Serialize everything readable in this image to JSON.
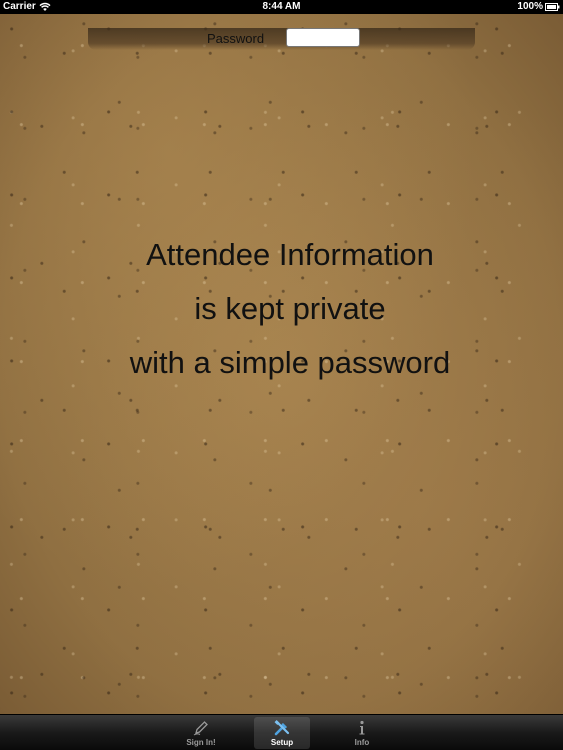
{
  "status_bar": {
    "carrier": "Carrier",
    "time": "8:44 AM",
    "battery": "100%"
  },
  "password": {
    "label": "Password",
    "value": "",
    "placeholder": ""
  },
  "message": {
    "lines": [
      "Attendee Information",
      "is kept private",
      "with a simple password"
    ]
  },
  "tab_bar": {
    "tabs": [
      {
        "label": "Sign In!",
        "icon": "pencil-icon",
        "selected": false
      },
      {
        "label": "Setup",
        "icon": "tools-icon",
        "selected": true
      },
      {
        "label": "Info",
        "icon": "info-icon",
        "selected": false
      }
    ],
    "selected_color": "#4fa3e0"
  }
}
